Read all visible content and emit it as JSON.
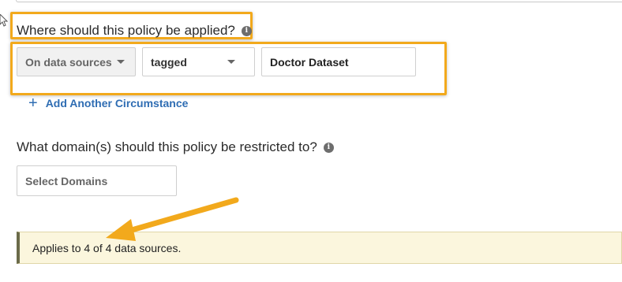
{
  "circumstance": {
    "question": "Where should this policy be applied?",
    "source_select": "On data sources",
    "condition_select": "tagged",
    "tag_value": "Doctor Dataset",
    "add_link": "Add Another Circumstance"
  },
  "domains": {
    "question": "What domain(s) should this policy be restricted to?",
    "placeholder": "Select Domains"
  },
  "notice": {
    "text": "Applies to 4 of 4 data sources."
  },
  "colors": {
    "highlight": "#f2a91c",
    "link": "#2f6db3",
    "notice_bg": "#fbf6dd"
  }
}
